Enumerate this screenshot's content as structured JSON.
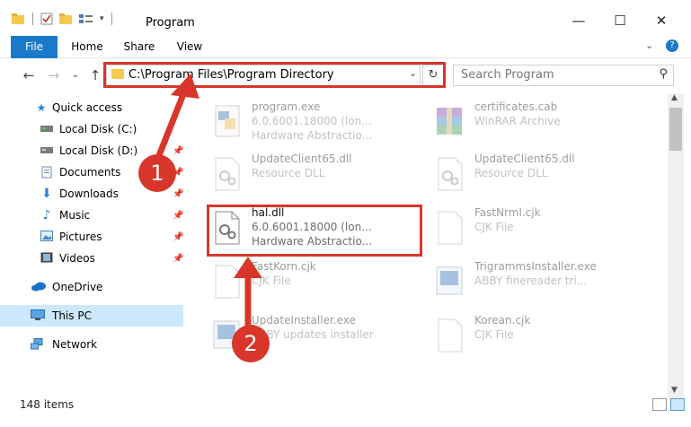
{
  "window": {
    "title": "Program",
    "min": "—",
    "max": "☐",
    "close": "✕"
  },
  "ribbon": {
    "tabs": [
      "File",
      "Home",
      "Share",
      "View"
    ]
  },
  "address": {
    "path": "C:\\Program Files\\Program Directory",
    "search_placeholder": "Search Program"
  },
  "sidebar": {
    "items": [
      {
        "label": "Quick access",
        "icon": "star-icon"
      },
      {
        "label": "Local Disk (C:)",
        "icon": "drive-icon"
      },
      {
        "label": "Local Disk (D:)",
        "icon": "drive-icon"
      },
      {
        "label": "Documents",
        "icon": "documents-icon"
      },
      {
        "label": "Downloads",
        "icon": "downloads-icon"
      },
      {
        "label": "Music",
        "icon": "music-icon"
      },
      {
        "label": "Pictures",
        "icon": "pictures-icon"
      },
      {
        "label": "Videos",
        "icon": "videos-icon"
      },
      {
        "label": "OneDrive",
        "icon": "cloud-icon"
      },
      {
        "label": "This PC",
        "icon": "pc-icon"
      },
      {
        "label": "Network",
        "icon": "network-icon"
      }
    ]
  },
  "files": [
    {
      "name": "program.exe",
      "line1": "6.0.6001.18000 (lon...",
      "line2": "Hardware Abstractio..."
    },
    {
      "name": "certificates.cab",
      "line1": "WinRAR Archive",
      "line2": ""
    },
    {
      "name": "UpdateClient65.dll",
      "line1": "Resource DLL",
      "line2": ""
    },
    {
      "name": "UpdateClient65.dll",
      "line1": "Resource DLL",
      "line2": ""
    },
    {
      "name": "hal.dll",
      "line1": "6.0.6001.18000 (lon...",
      "line2": "Hardware Abstractio..."
    },
    {
      "name": "FastNrml.cjk",
      "line1": "CJK File",
      "line2": ""
    },
    {
      "name": "FastKorn.cjk",
      "line1": "CJK File",
      "line2": ""
    },
    {
      "name": "TrigrammsInstaller.exe",
      "line1": "ABBY finereader tri...",
      "line2": ""
    },
    {
      "name": "UpdateInstaller.exe",
      "line1": "ABBY updates installer",
      "line2": ""
    },
    {
      "name": "Korean.cjk",
      "line1": "CJK File",
      "line2": ""
    }
  ],
  "status": {
    "items": "148 items"
  },
  "callouts": [
    "1",
    "2"
  ],
  "colors": {
    "accent": "#1979ca",
    "highlight": "#d9362b",
    "selected": "#cce8ff"
  }
}
